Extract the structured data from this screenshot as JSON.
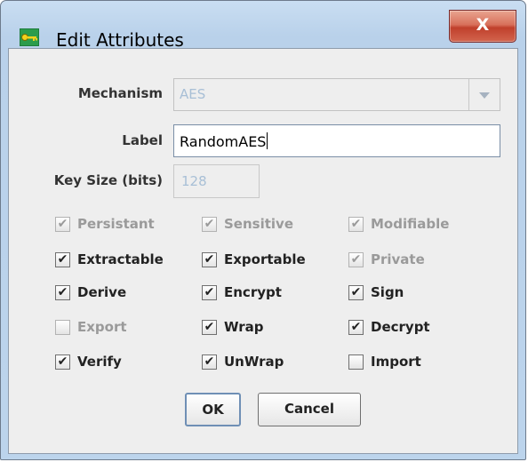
{
  "window": {
    "title": "Edit Attributes",
    "close_label": "X",
    "icon": "key-icon"
  },
  "form": {
    "mechanism": {
      "label": "Mechanism",
      "value": "AES"
    },
    "label_field": {
      "label": "Label",
      "value": "RandomAES"
    },
    "key_size": {
      "label": "Key Size (bits)",
      "value": "128"
    }
  },
  "checkboxes": [
    {
      "label": "Persistant",
      "checked": true,
      "enabled": false
    },
    {
      "label": "Sensitive",
      "checked": true,
      "enabled": false
    },
    {
      "label": "Modifiable",
      "checked": true,
      "enabled": false
    },
    {
      "label": "Extractable",
      "checked": true,
      "enabled": true
    },
    {
      "label": "Exportable",
      "checked": true,
      "enabled": true
    },
    {
      "label": "Private",
      "checked": true,
      "enabled": false
    },
    {
      "label": "Derive",
      "checked": true,
      "enabled": true
    },
    {
      "label": "Encrypt",
      "checked": true,
      "enabled": true
    },
    {
      "label": "Sign",
      "checked": true,
      "enabled": true
    },
    {
      "label": "Export",
      "checked": false,
      "enabled": false
    },
    {
      "label": "Wrap",
      "checked": true,
      "enabled": true
    },
    {
      "label": "Decrypt",
      "checked": true,
      "enabled": true
    },
    {
      "label": "Verify",
      "checked": true,
      "enabled": true
    },
    {
      "label": "UnWrap",
      "checked": true,
      "enabled": true
    },
    {
      "label": "Import",
      "checked": false,
      "enabled": true
    }
  ],
  "buttons": {
    "ok": "OK",
    "cancel": "Cancel"
  },
  "colors": {
    "titlebar": "#b9d1ea",
    "client_bg": "#eeeeee",
    "close_red": "#c7452f",
    "disabled_text": "#9a9a9a"
  }
}
